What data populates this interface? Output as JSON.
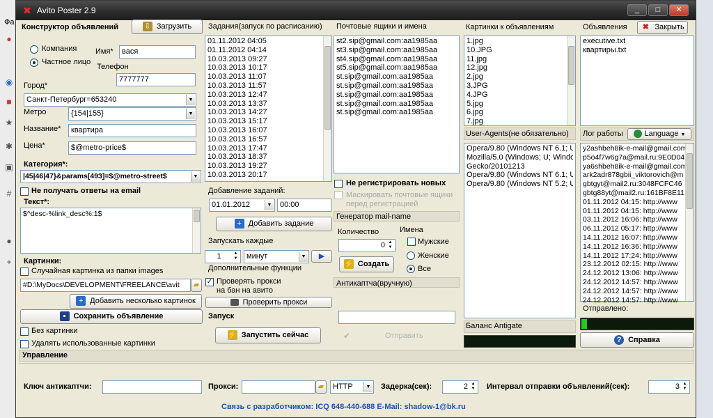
{
  "window": {
    "title": "Avito Poster 2.9",
    "min": "_",
    "max": "□",
    "close": "✕"
  },
  "constructor": {
    "header": "Конструктор объявлений",
    "load_btn": "Загрузить",
    "company": "Компания",
    "private": "Частное лицо",
    "name_label": "Имя*",
    "name_value": "вася",
    "phone_label": "Телефон",
    "phone_value": "7777777",
    "city_label": "Город*",
    "city_value": "Санкт-Петербург=653240",
    "metro_label": "Метро",
    "metro_value": "{154|155}",
    "title_label": "Название*",
    "title_value": "квартира",
    "price_label": "Цена*",
    "price_value": "$@metro-price$",
    "category_label": "Категория*:",
    "category_value": "|45|46|47}&params[493]=$@metro-street$",
    "no_email_label": "Не получать ответы на email",
    "text_label": "Текст*:",
    "text_value": "$^desc-%link_desc%:1$",
    "images_label": "Картинки:",
    "random_img_label": "Случайная картинка из папки images",
    "images_path": "#D:\\MyDocs\\DEVELOPMENT\\FREELANCE\\avit",
    "add_images_btn": "Добавить несколько картинок",
    "save_btn": "Сохранить объявление",
    "no_images_label": "Без картинки",
    "delete_used_label": "Удалять использованные картинки"
  },
  "tasks": {
    "header": "Задания(запуск по расписанию)",
    "items": [
      "01.11.2012 04:05",
      "01.11.2012 04:14",
      "10.03.2013 09:27",
      "10.03.2013 10:17",
      "10.03.2013 11:07",
      "10.03.2013 11:57",
      "10.03.2013 12:47",
      "10.03.2013 13:37",
      "10.03.2013 14:27",
      "10.03.2013 15:17",
      "10.03.2013 16:07",
      "10.03.2013 16:57",
      "10.03.2013 17:47",
      "10.03.2013 18:37",
      "10.03.2013 19:27",
      "10.03.2013 20:17"
    ],
    "add_header": "Добавление заданий:",
    "date_value": "01.01.2012",
    "time_value": "00:00",
    "add_btn": "Добавить задание",
    "every_header": "Запускать каждые",
    "every_value": "1",
    "every_unit": "минут",
    "extra_header": "Дополнительные функции",
    "check_proxy_label": "Проверять прокси",
    "check_proxy_label2": "на бан на авито",
    "check_proxy_btn": "Проверить прокси",
    "launch_header": "Запуск",
    "launch_btn": "Запустить сейчас"
  },
  "mail": {
    "header": "Почтовые ящики и имена",
    "items": [
      "st2.sip@gmail.com:aa1985aa",
      "st3.sip@gmail.com:aa1985aa",
      "st4.sip@gmail.com:aa1985aa",
      "st5.sip@gmail.com:aa1985aa",
      "st.sip@gmail.com:aa1985aa",
      "st.sip@gmail.com:aa1985aa",
      "st.sip@gmail.com:aa1985aa",
      "st.sip@gmail.com:aa1985aa",
      "st.sip@gmail.com:aa1985aa"
    ],
    "no_register_label": "Не регистрировать новых",
    "disabled1": "Маскировать почтовые ящики",
    "disabled2": "перед регистрацией",
    "gen_header": "Генератор mail-name",
    "qty_label": "Количество",
    "qty_value": "0",
    "create_btn": "Создать",
    "names_label": "Имена",
    "male": "Мужские",
    "female": "Женские",
    "all": "Все",
    "anticaptcha_header": "Антикаптча(вручную)",
    "send_btn": "Отправить"
  },
  "pictures": {
    "header": "Картинки к объявлениям",
    "items": [
      "1.jpg",
      "10.JPG",
      "11.jpg",
      "12.jpg",
      "2.jpg",
      "3.JPG",
      "4.JPG",
      "5.jpg",
      "6.jpg",
      "7.jpg"
    ],
    "ua_header": "User-Agents(не обязательно)",
    "ua_items": [
      "Opera/9.80 (Windows NT 6.1; U;",
      "Mozilla/5.0 (Windows; U; Windo",
      "Gecko/20101213",
      "Opera/9.80 (Windows NT 6.1; U;",
      "Opera/9.80 (Windows NT 5.2; U;"
    ],
    "balance_label": "Баланс Antigate"
  },
  "ads": {
    "header": "Объявления",
    "close_btn": "Закрыть",
    "items": [
      "executive.txt",
      "квартиры.txt"
    ],
    "log_header": "Лог работы",
    "language_btn": "Language",
    "log_items": [
      "y2ashbeh8ik-e-mail@gmail.com",
      "p5o4f7w6g7a@mail.ru:9E0D04",
      "ya6shbeh8ik-e-mail@gmail.com",
      "ark2adr878gbii_viktorovich@m",
      "gbtgyt@mail2.ru:3048FCFC46",
      "gbtg88yt@mail2.ru:161BF8E11",
      "01.11.2012 04:15:  http://www",
      "01.11.2012 04:15:  http://www",
      "03.11.2012 16:06:  http://www",
      "06.11.2012 05:17:  http://www",
      "14.11.2012 16:07:  http://www",
      "14.11.2012 16:36:  http://www",
      "14.11.2012 17:24:  http://www",
      "23.12.2012 02:15:  http://www",
      "24.12.2012 13:06:  http://www",
      "24.12.2012 14:57:  http://www",
      "24.12.2012 14:57:  http://www",
      "24.12.2012 14:57:  http://www"
    ],
    "sent_label": "Отправлено:",
    "help_btn": "Справка"
  },
  "control": {
    "header": "Управление",
    "captcha_key_label": "Ключ антикаптчи:",
    "captcha_key_value": "",
    "proxy_label": "Прокси:",
    "proxy_value": "",
    "proxy_type": "HTTP",
    "delay_label": "Задерка(сек):",
    "delay_value": "2",
    "interval_label": "Интервал отправки объявлений(сек):",
    "interval_value": "3"
  },
  "footer": {
    "contact": "Связь с разработчиком: ICQ 648-440-688 E-Mail: shadow-1@bk.ru"
  },
  "background": {
    "left_text": "Фа"
  },
  "colors": {
    "title_bg": "#2a2a2a",
    "window_bg": "#ece9d8",
    "link_blue": "#1e50b4",
    "log_dark": "#0b1a0b"
  }
}
